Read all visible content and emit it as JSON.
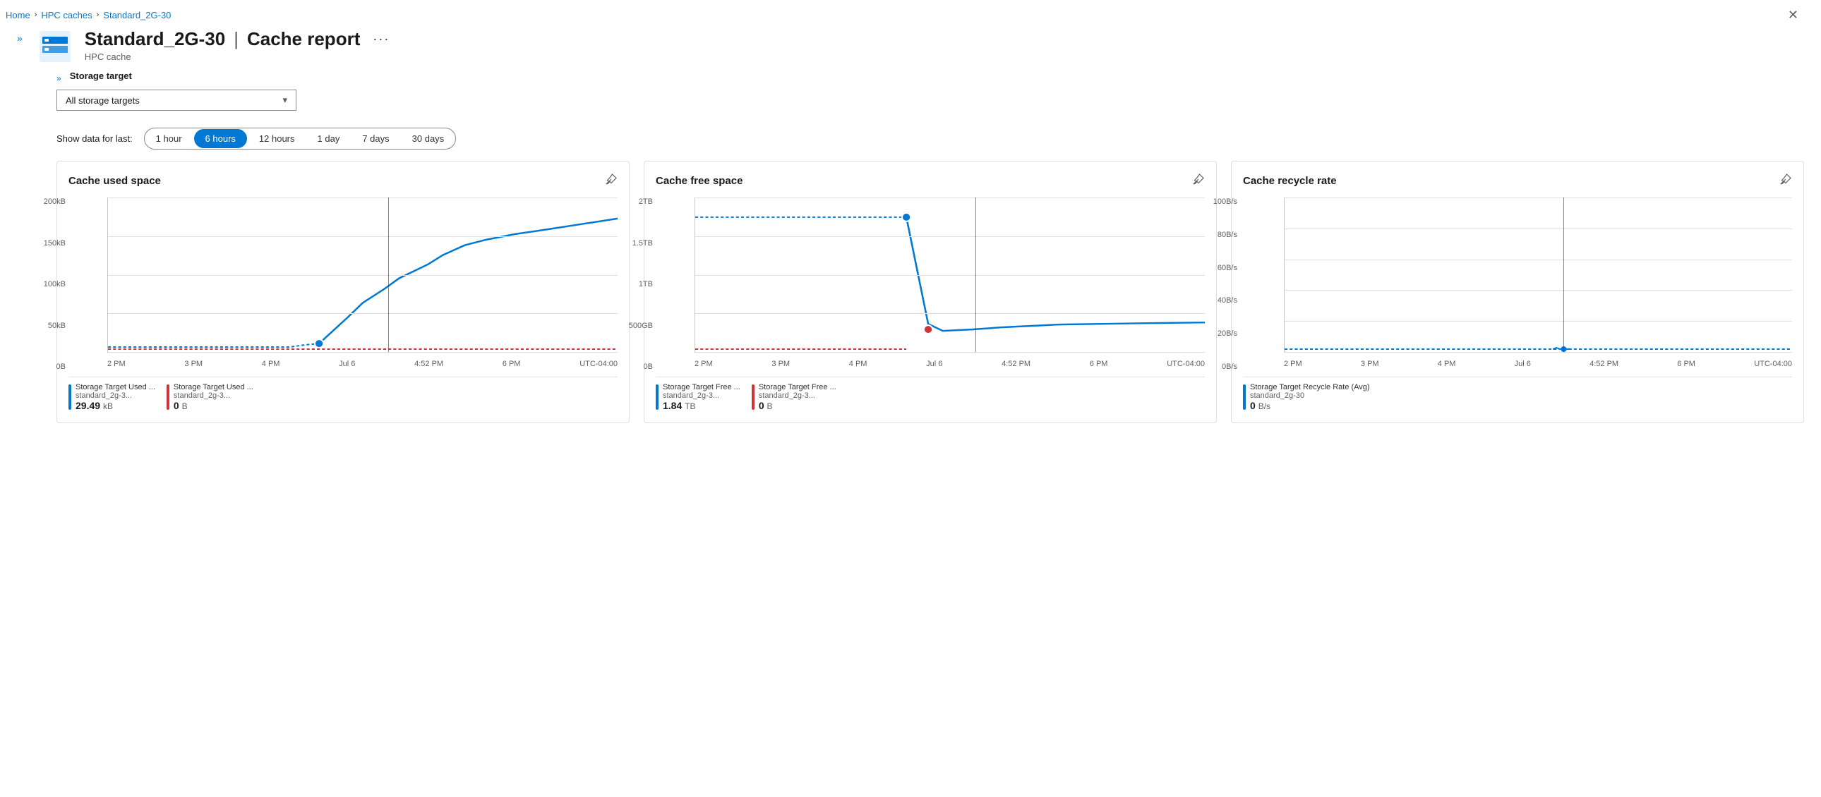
{
  "breadcrumb": {
    "home": "Home",
    "hpc_caches": "HPC caches",
    "current": "Standard_2G-30"
  },
  "header": {
    "title": "Standard_2G-30",
    "separator": "|",
    "page_name": "Cache report",
    "subtitle": "HPC cache",
    "more_label": "···"
  },
  "sidebar": {
    "collapse_label": "»",
    "expand_label": "»"
  },
  "storage_target": {
    "label": "Storage target",
    "value": "All storage targets",
    "dropdown_icon": "▾"
  },
  "time_filter": {
    "label": "Show data for last:",
    "options": [
      {
        "label": "1 hour",
        "value": "1h",
        "active": false
      },
      {
        "label": "6 hours",
        "value": "6h",
        "active": true
      },
      {
        "label": "12 hours",
        "value": "12h",
        "active": false
      },
      {
        "label": "1 day",
        "value": "1d",
        "active": false
      },
      {
        "label": "7 days",
        "value": "7d",
        "active": false
      },
      {
        "label": "30 days",
        "value": "30d",
        "active": false
      }
    ]
  },
  "charts": {
    "used_space": {
      "title": "Cache used space",
      "pin_label": "📌",
      "y_labels": [
        "200kB",
        "150kB",
        "100kB",
        "50kB",
        "0B"
      ],
      "x_labels": [
        "2 PM",
        "3 PM",
        "4 PM",
        "Jul 6",
        "4:52 PM",
        "6 PM",
        "UTC-04:00"
      ],
      "legend": [
        {
          "label": "Storage Target Used ...",
          "sublabel": "standard_2g-3...",
          "value": "29.49",
          "unit": "kB",
          "color": "#0078d4"
        },
        {
          "label": "Storage Target Used ...",
          "sublabel": "standard_2g-3...",
          "value": "0",
          "unit": "B",
          "color": "#d13438"
        }
      ]
    },
    "free_space": {
      "title": "Cache free space",
      "pin_label": "📌",
      "y_labels": [
        "2TB",
        "1.5TB",
        "1TB",
        "500GB",
        "0B"
      ],
      "x_labels": [
        "2 PM",
        "3 PM",
        "4 PM",
        "Jul 6",
        "4:52 PM",
        "6 PM",
        "UTC-04:00"
      ],
      "legend": [
        {
          "label": "Storage Target Free ...",
          "sublabel": "standard_2g-3...",
          "value": "1.84",
          "unit": "TB",
          "color": "#0078d4"
        },
        {
          "label": "Storage Target Free ...",
          "sublabel": "standard_2g-3...",
          "value": "0",
          "unit": "B",
          "color": "#d13438"
        }
      ]
    },
    "recycle_rate": {
      "title": "Cache recycle rate",
      "pin_label": "📌",
      "y_labels": [
        "100B/s",
        "80B/s",
        "60B/s",
        "40B/s",
        "20B/s",
        "0B/s"
      ],
      "x_labels": [
        "2 PM",
        "3 PM",
        "4 PM",
        "Jul 6",
        "4:52 PM",
        "6 PM",
        "UTC-04:00"
      ],
      "legend": [
        {
          "label": "Storage Target Recycle Rate (Avg)",
          "sublabel": "standard_2g-30",
          "value": "0",
          "unit": "B/s",
          "color": "#0078d4"
        }
      ]
    }
  },
  "icons": {
    "close": "✕",
    "pin": "⊹",
    "chevron_down": "⌄",
    "collapse": "»"
  }
}
